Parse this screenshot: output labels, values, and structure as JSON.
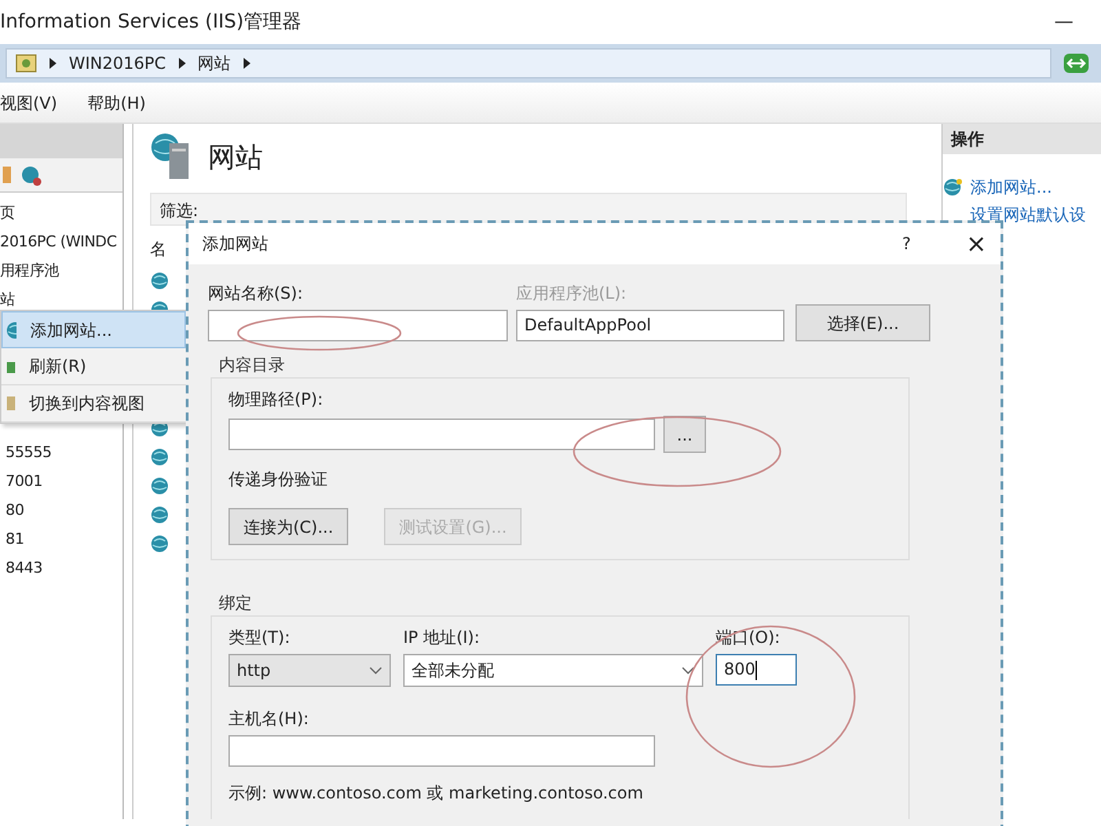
{
  "window": {
    "title": "Information Services (IIS)管理器",
    "minimize": "—"
  },
  "address_bar": {
    "segments": [
      "WIN2016PC",
      "网站"
    ]
  },
  "menu_bar": [
    "视图(V)",
    "帮助(H)"
  ],
  "connections": {
    "items": [
      {
        "label": "页"
      },
      {
        "label": "2016PC (WINDC"
      },
      {
        "label": "用程序池"
      },
      {
        "label": "站",
        "children": [
          {
            "label": "55555"
          },
          {
            "label": "7001"
          },
          {
            "label": "80"
          },
          {
            "label": "81"
          },
          {
            "label": "8443"
          }
        ]
      }
    ]
  },
  "context_menu": [
    {
      "label": "添加网站...",
      "selected": true
    },
    {
      "label": "刷新(R)",
      "selected": false
    },
    {
      "label": "切换到内容视图",
      "selected": false
    }
  ],
  "sites_view": {
    "title": "网站",
    "filter_label": "筛选:",
    "column": "名"
  },
  "actions": {
    "title": "操作",
    "links": [
      "添加网站...",
      "设置网站默认设"
    ]
  },
  "dialog": {
    "title": "添加网站",
    "help": "?",
    "close": "×",
    "site_name": {
      "label": "网站名称(S):"
    },
    "app_pool": {
      "label": "应用程序池(L):",
      "value": "DefaultAppPool",
      "disabled": true
    },
    "select_button": "选择(E)...",
    "content_group": {
      "title": "内容目录",
      "path_label": "物理路径(P):",
      "browse_button": "...",
      "auth_label": "传递身份验证",
      "buttons": [
        {
          "label": "连接为(C)...",
          "disabled": false
        },
        {
          "label": "测试设置(G)...",
          "disabled": true
        }
      ]
    },
    "binding_group": {
      "title": "绑定",
      "type_label": "类型(T):",
      "type_value": "http",
      "ip_label": "IP 地址(I):",
      "ip_value": "全部未分配",
      "port_label": "端口(O):",
      "port_value": "800",
      "host_label": "主机名(H):",
      "example": "示例: www.contoso.com 或 marketing.contoso.com"
    }
  }
}
